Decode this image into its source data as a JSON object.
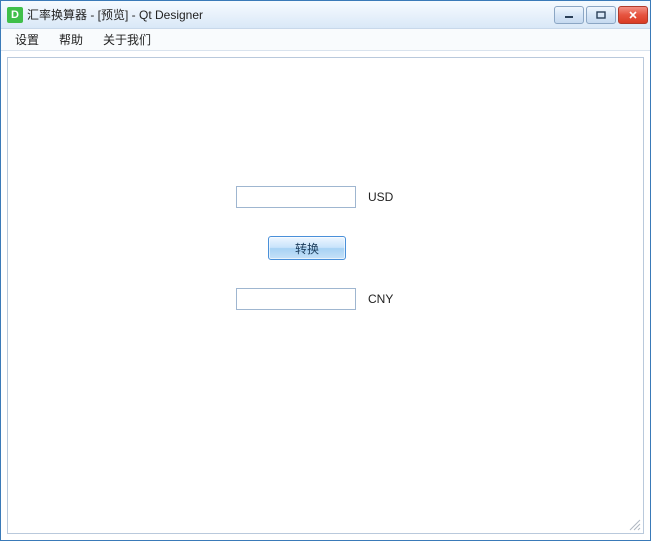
{
  "window": {
    "icon_letter": "D",
    "title": "汇率换算器 - [预览] - Qt Designer"
  },
  "menu": {
    "items": [
      "设置",
      "帮助",
      "关于我们"
    ]
  },
  "form": {
    "input_usd_value": "",
    "usd_label": "USD",
    "convert_button_label": "转换",
    "input_cny_value": "",
    "cny_label": "CNY"
  }
}
